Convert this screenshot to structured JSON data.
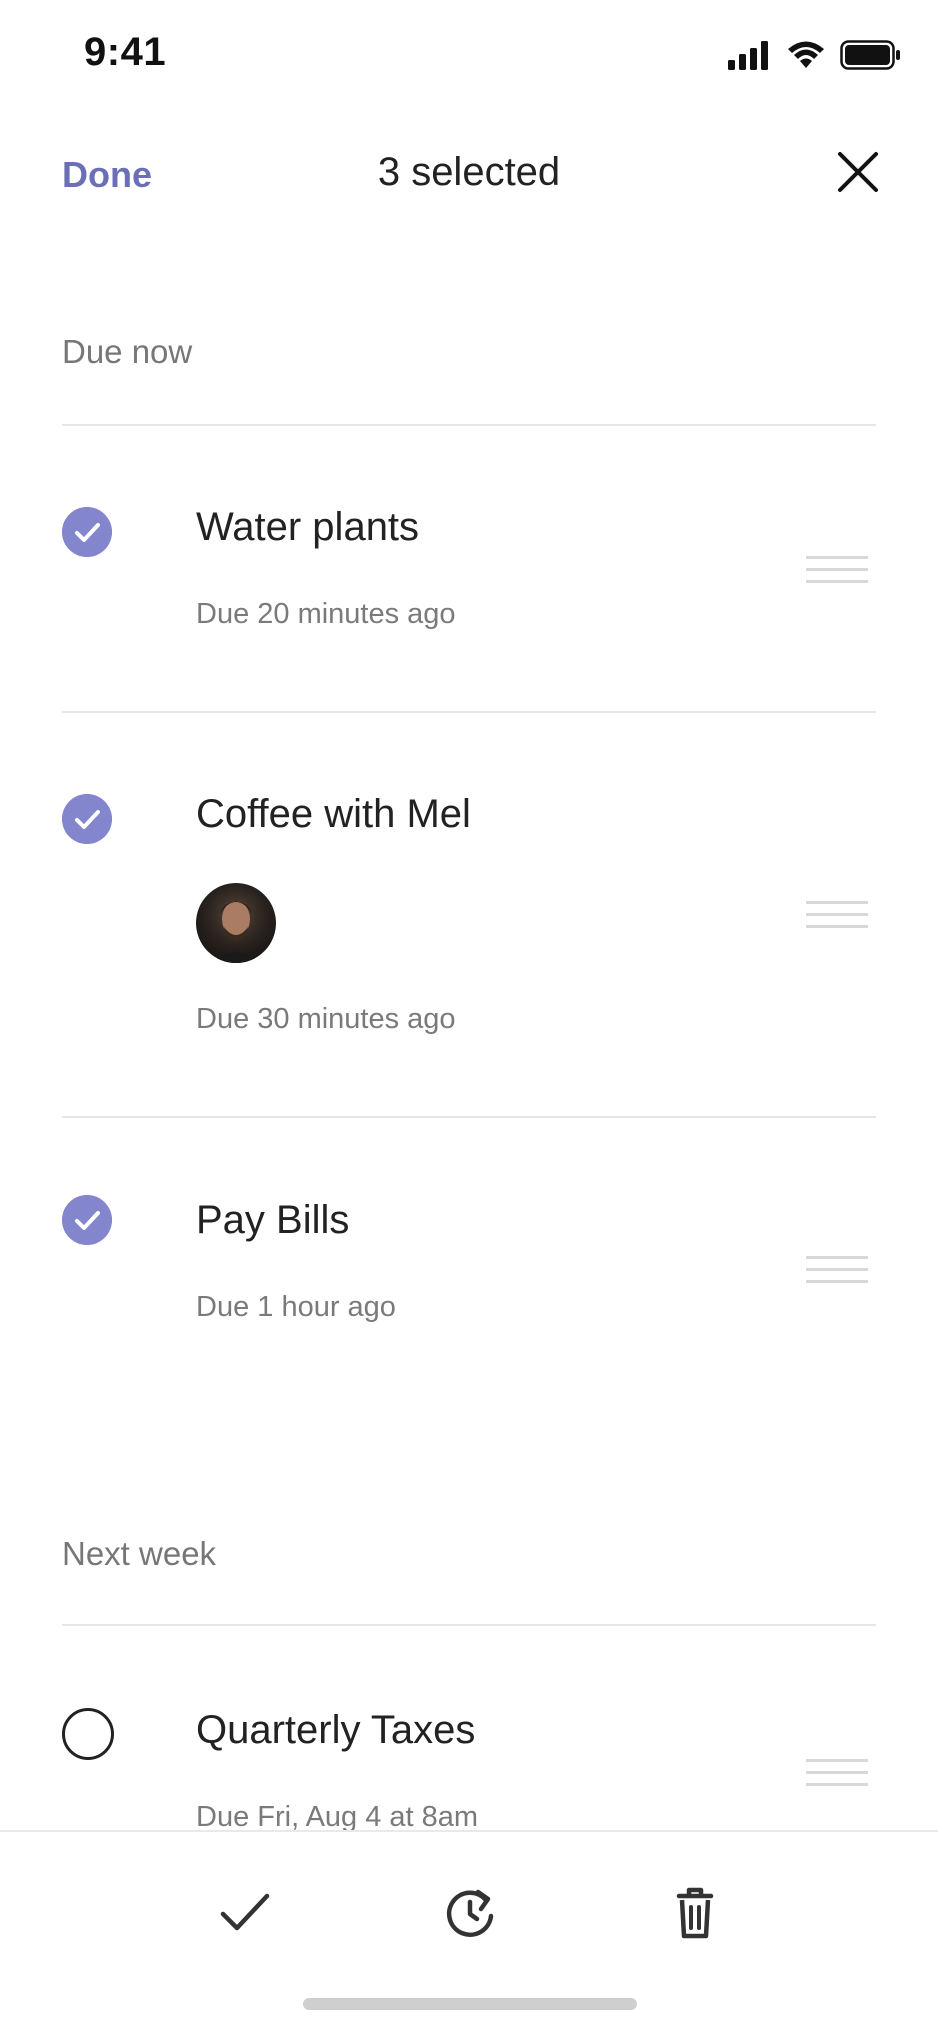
{
  "status_bar": {
    "time": "9:41"
  },
  "header": {
    "done_label": "Done",
    "title": "3 selected"
  },
  "sections": [
    {
      "label": "Due now",
      "tasks": [
        {
          "title": "Water plants",
          "due": "Due 20 minutes ago",
          "selected": true
        },
        {
          "title": "Coffee with Mel",
          "due": "Due 30 minutes ago",
          "selected": true,
          "has_avatar": true
        },
        {
          "title": "Pay Bills",
          "due": "Due 1 hour ago",
          "selected": true
        }
      ]
    },
    {
      "label": "Next week",
      "tasks": [
        {
          "title": "Quarterly Taxes",
          "due": "Due Fri, Aug 4 at 8am",
          "selected": false
        }
      ]
    }
  ],
  "toolbar": {
    "icons": [
      "check-icon",
      "snooze-icon",
      "trash-icon"
    ]
  },
  "colors": {
    "accent": "#8386cc",
    "done_text": "#6b6fb8"
  }
}
